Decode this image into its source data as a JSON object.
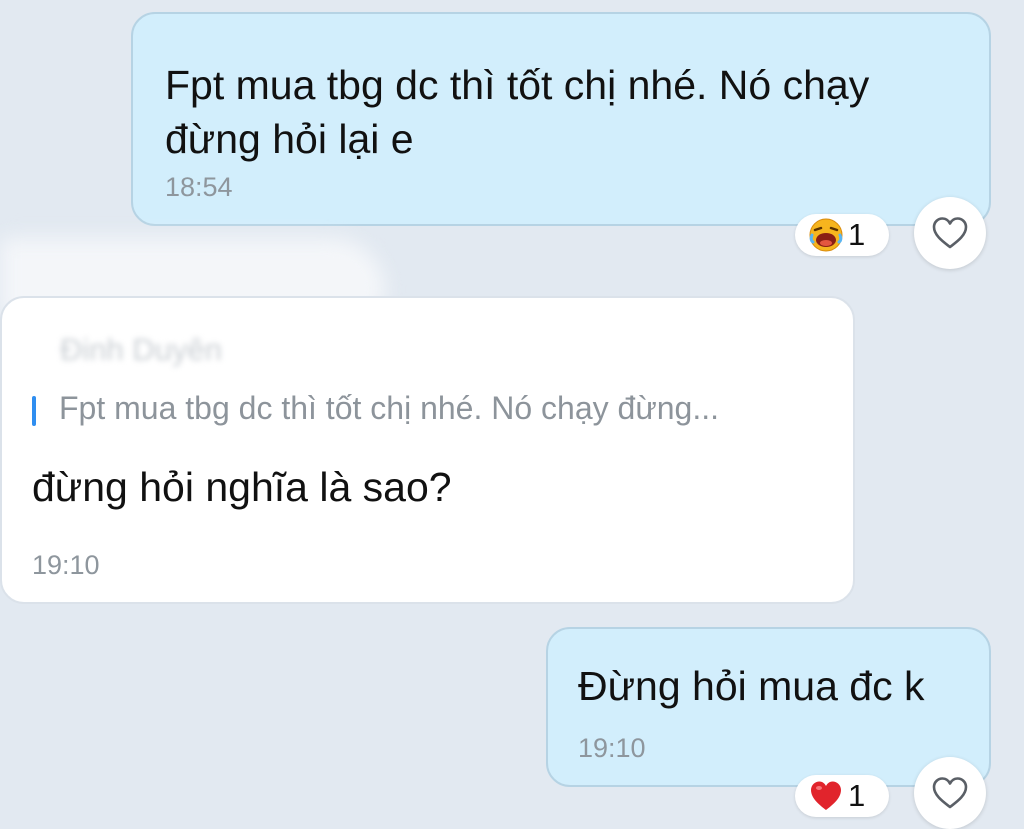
{
  "messages": [
    {
      "direction": "sent",
      "text": "Fpt mua tbg dc thì tốt chị nhé. Nó chạy\nđừng hỏi lại e",
      "time": "18:54",
      "reaction": {
        "emoji": "laughing-face",
        "count": "1"
      }
    },
    {
      "direction": "received",
      "sender": "Đinh Duyên",
      "quote": "Fpt mua tbg dc thì tốt chị nhé. Nó chạy đừng...",
      "text": "đừng hỏi nghĩa là sao?",
      "time": "19:10"
    },
    {
      "direction": "sent",
      "text": "Đừng hỏi mua đc k",
      "time": "19:10",
      "reaction": {
        "emoji": "red-heart",
        "count": "1"
      }
    }
  ],
  "colors": {
    "background": "#e2e9f1",
    "sent_bubble": "#d2eefc",
    "received_bubble": "#ffffff",
    "quote_accent": "#2f8ef0",
    "timestamp": "#8e969d"
  },
  "icons": {
    "react_button": "heart-outline-icon"
  }
}
